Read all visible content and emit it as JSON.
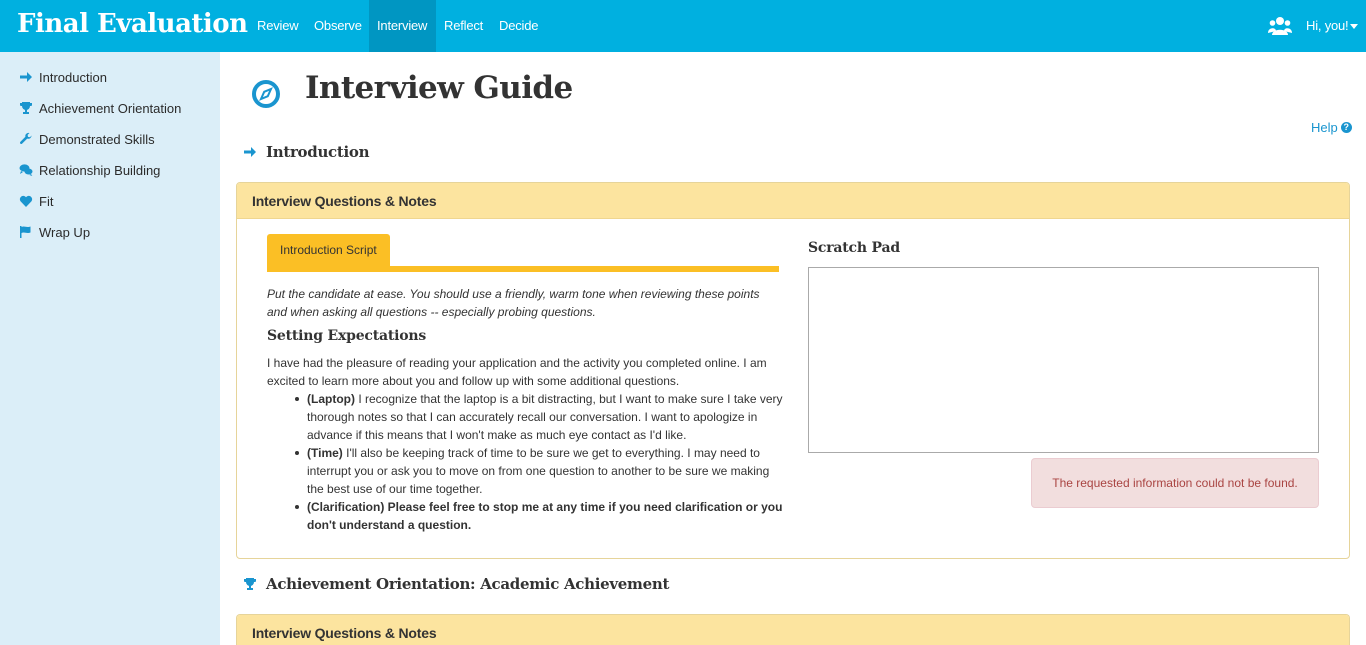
{
  "app": {
    "title": "Final Evaluation"
  },
  "nav": {
    "tabs": [
      {
        "label": "Review"
      },
      {
        "label": "Observe"
      },
      {
        "label": "Interview"
      },
      {
        "label": "Reflect"
      },
      {
        "label": "Decide"
      }
    ],
    "active_tab": "Interview",
    "user_label": "Hi, you!"
  },
  "sidebar": {
    "items": [
      {
        "label": "Introduction",
        "icon": "arrow-right-icon"
      },
      {
        "label": "Achievement Orientation",
        "icon": "trophy-icon"
      },
      {
        "label": "Demonstrated Skills",
        "icon": "wrench-icon"
      },
      {
        "label": "Relationship Building",
        "icon": "comments-icon"
      },
      {
        "label": "Fit",
        "icon": "heart-icon"
      },
      {
        "label": "Wrap Up",
        "icon": "flag-icon"
      }
    ]
  },
  "page": {
    "title": "Interview Guide",
    "help_label": "Help"
  },
  "sections": [
    {
      "title": "Introduction",
      "panel_title": "Interview Questions & Notes",
      "tab_label": "Introduction Script",
      "instruction": "Put the candidate at ease. You should use a friendly, warm tone when reviewing these points and when asking all questions -- especially probing questions.",
      "subheading": "Setting Expectations",
      "body": "I have had the pleasure of reading your application and the activity you completed online. I am excited to learn more about you and follow up with some additional questions.",
      "bullets": [
        {
          "lead": "(Laptop)",
          "text": " I recognize that the laptop is a bit distracting, but I want to make sure I take very thorough notes so that I can accurately recall our conversation. I want to apologize in advance if this means that I won't make as much eye contact as I'd like."
        },
        {
          "lead": "(Time)",
          "text": " I'll also be keeping track of time to be sure we get to everything. I may need to interrupt you or ask you to move on from one question to another to be sure we making the best use of our time together."
        },
        {
          "lead": "(Clarification) Please feel free to stop me at any time if you need clarification or you don't understand a question.",
          "text": ""
        }
      ],
      "scratch_label": "Scratch Pad",
      "scratch_value": "",
      "alert": "The requested information could not be found."
    },
    {
      "title": "Achievement Orientation: Academic Achievement",
      "panel_title": "Interview Questions & Notes"
    }
  ],
  "colors": {
    "navbar": "#00b0e0",
    "nav_active": "#0096c2",
    "sidebar": "#dbeef8",
    "accent": "#1a95cf",
    "panel_head": "#fce49f",
    "tab": "#fbbf25",
    "alert_bg": "#f2dede",
    "alert_text": "#a94442"
  }
}
